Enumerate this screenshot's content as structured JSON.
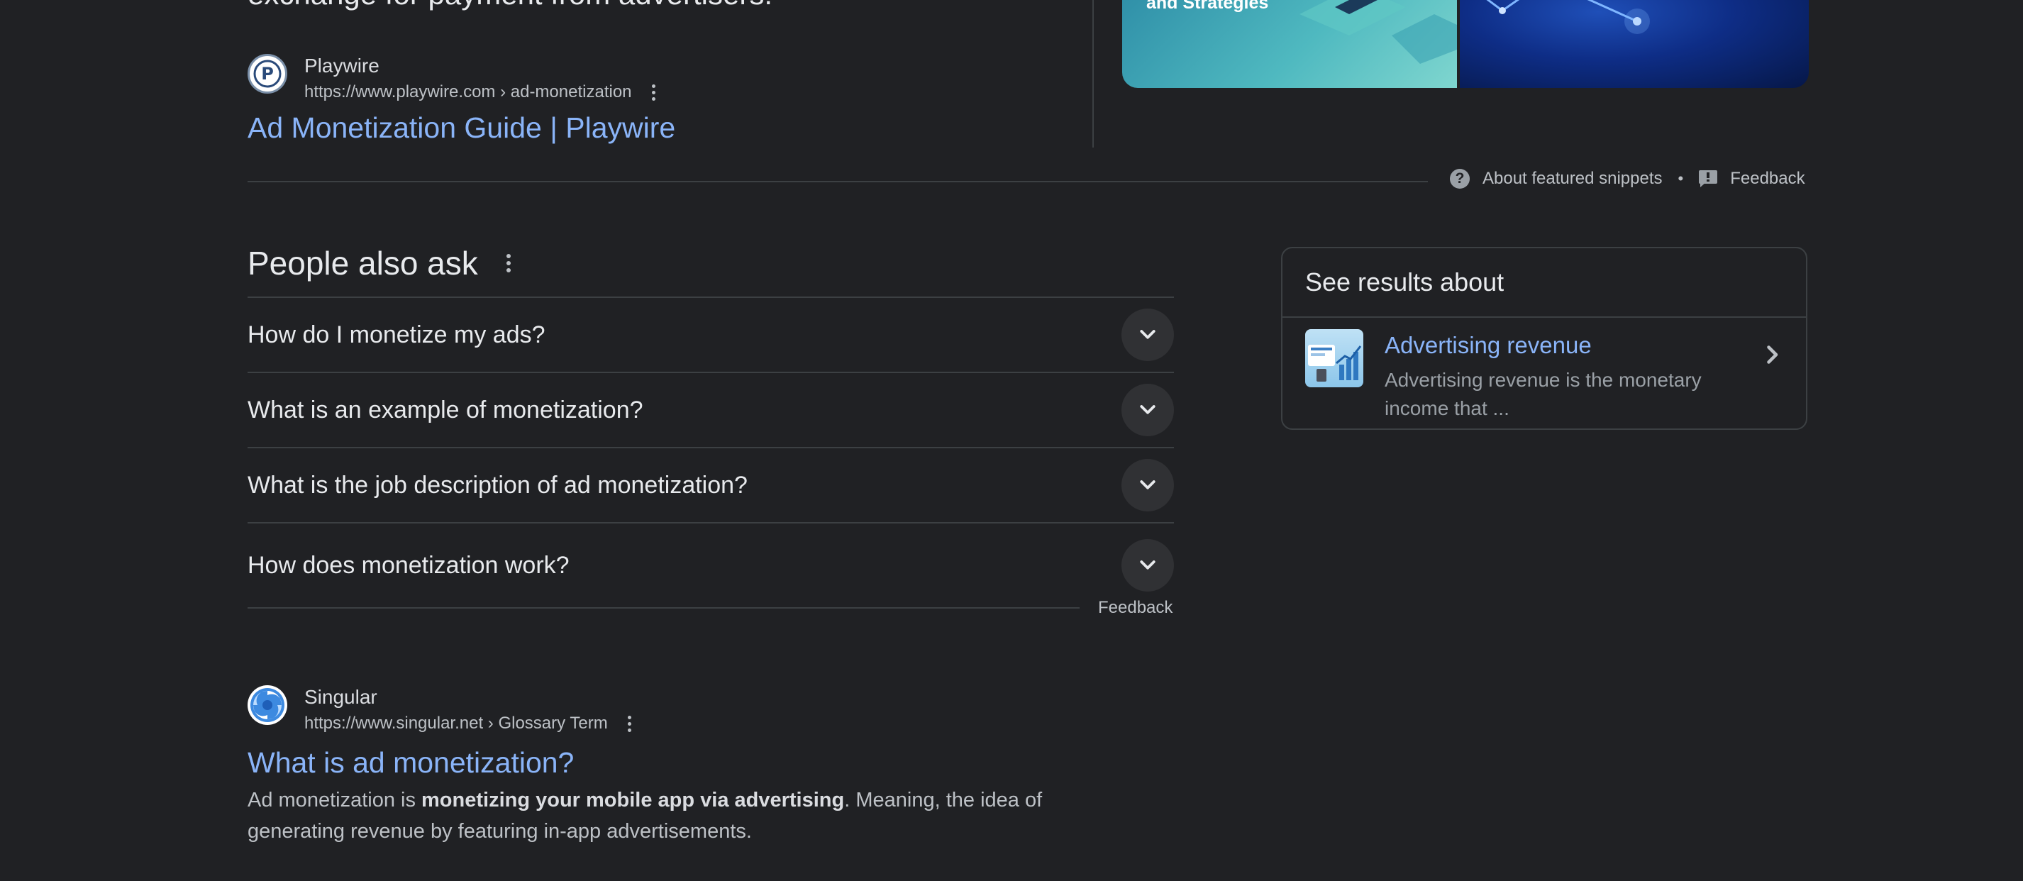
{
  "top_snippet": {
    "text_fragment": "exchange for payment from advertisers.",
    "image_left_caption": "and Strategies"
  },
  "playwire_result": {
    "site_name": "Playwire",
    "url": "https://www.playwire.com › ad-monetization",
    "title": "Ad Monetization Guide | Playwire"
  },
  "snippet_meta": {
    "about_label": "About featured snippets",
    "separator": "•",
    "feedback_label": "Feedback"
  },
  "people_also_ask": {
    "title": "People also ask",
    "questions": [
      "How do I monetize my ads?",
      "What is an example of monetization?",
      "What is the job description of ad monetization?",
      "How does monetization work?"
    ],
    "feedback_label": "Feedback"
  },
  "see_results_about": {
    "heading": "See results about",
    "entity_title": "Advertising revenue",
    "entity_description": "Advertising revenue is the monetary income that ..."
  },
  "singular_result": {
    "site_name": "Singular",
    "url": "https://www.singular.net › Glossary Term",
    "title": "What is ad monetization?",
    "desc_prefix": "Ad monetization is ",
    "desc_bold": "monetizing your mobile app via advertising",
    "desc_suffix": ". Meaning, the idea of generating revenue by featuring in-app advertisements."
  },
  "colors": {
    "background": "#202124",
    "link": "#8ab4f8",
    "text": "#e8eaed",
    "muted": "#bdc1c6",
    "divider": "#3c4043"
  },
  "icons": [
    "playwire-favicon-icon",
    "kebab-menu-icon",
    "help-circle-icon",
    "feedback-icon",
    "chevron-down-icon",
    "chevron-right-icon",
    "singular-favicon-icon"
  ]
}
